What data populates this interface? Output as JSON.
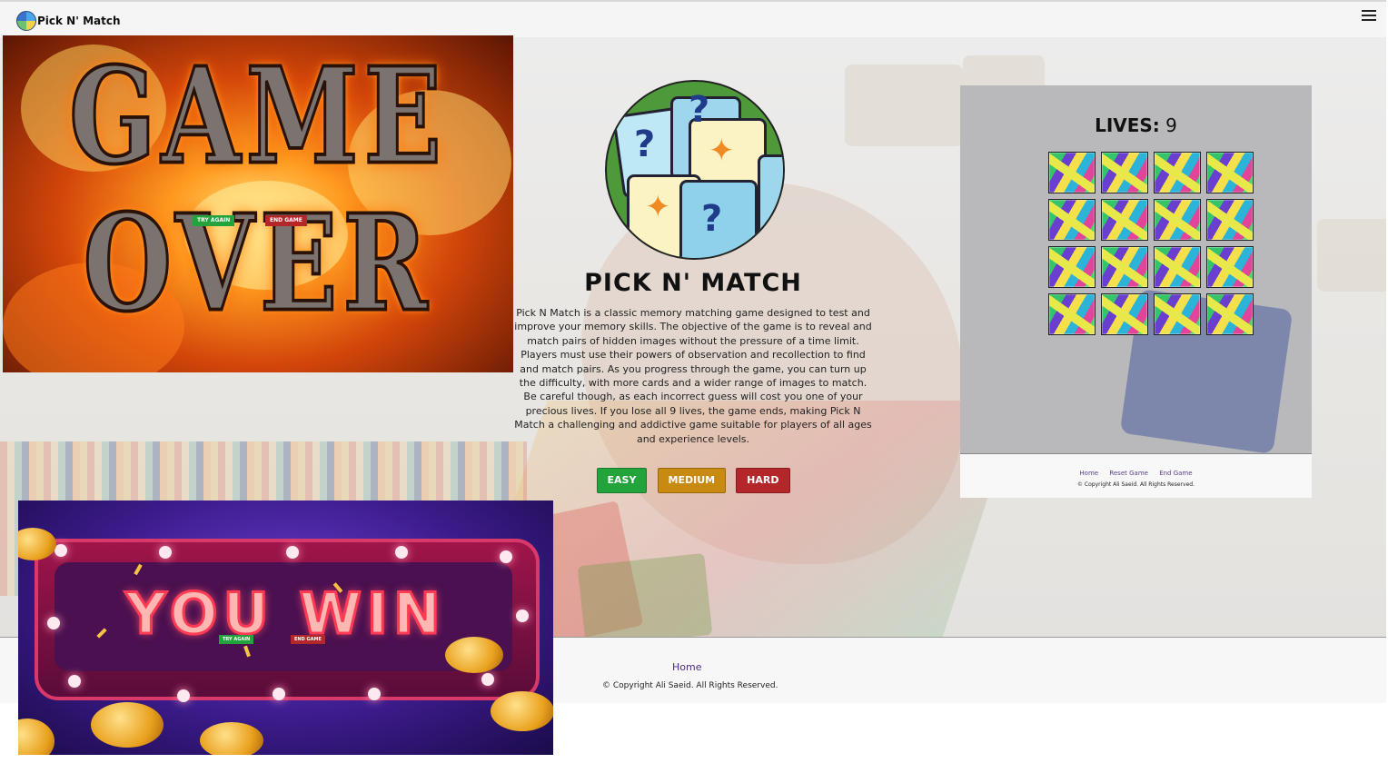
{
  "navbar": {
    "brand": "Pick N' Match",
    "menu_icon": "hamburger-menu-icon"
  },
  "hero": {
    "title": "PICK N' MATCH",
    "description": "Pick N Match is a classic memory matching game designed to test and improve your memory skills. The objective of the game is to reveal and match pairs of hidden images without the pressure of a time limit. Players must use their powers of observation and recollection to find and match pairs. As you progress through the game, you can turn up the difficulty, with more cards and a wider range of images to match. Be careful though, as each incorrect guess will cost you one of your precious lives. If you lose all 9 lives, the game ends, making Pick N Match a challenging and addictive game suitable for players of all ages and experience levels.",
    "buttons": [
      {
        "label": "EASY",
        "color": "#22a33b"
      },
      {
        "label": "MEDIUM",
        "color": "#c98a12"
      },
      {
        "label": "HARD",
        "color": "#b3262a"
      }
    ]
  },
  "game_panel": {
    "lives_label": "LIVES:",
    "lives_value": "9",
    "card_count": 16,
    "footer_links": [
      "Home",
      "Reset Game",
      "End Game"
    ],
    "footer_copyright": "© Copyright Ali Saeid. All Rights Reserved."
  },
  "footer": {
    "home_link": "Home",
    "copyright": "© Copyright Ali Saeid. All Rights Reserved."
  },
  "game_over": {
    "line1": "GAME",
    "line2": "OVER",
    "try_again": "TRY AGAIN",
    "end_game": "END GAME"
  },
  "you_win": {
    "text": "YOU WIN",
    "try_again": "TRY AGAIN",
    "end_game": "END GAME"
  }
}
